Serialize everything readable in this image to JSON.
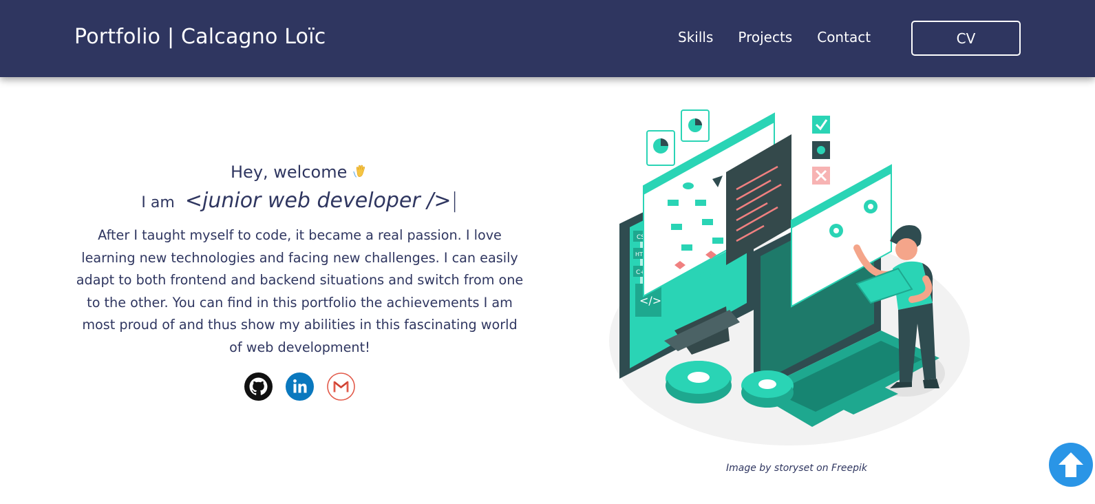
{
  "header": {
    "brand": "Portfolio | Calcagno Loïc",
    "nav": [
      {
        "label": "Skills"
      },
      {
        "label": "Projects"
      },
      {
        "label": "Contact"
      }
    ],
    "cv_label": "CV"
  },
  "hero": {
    "greeting": "Hey, welcome",
    "iam_prefix": "I am",
    "role": "<junior web developer />",
    "cursor": "|",
    "bio": "After I taught myself to code, it became a real passion. I love learning new technologies and facing new challenges. I can easily adapt to both frontend and backend situations and switch from one to the other. You can find in this portfolio the achievements I am most proud of and thus show my abilities in this fascinating world of web development!",
    "socials": [
      {
        "icon": "github-icon"
      },
      {
        "icon": "linkedin-icon"
      },
      {
        "icon": "gmail-icon"
      }
    ]
  },
  "illustration": {
    "credit": "Image by storyset on Freepik"
  },
  "colors": {
    "navbar": "#2f3660",
    "text": "#2f3660",
    "accent": "#1ed8b8",
    "scroll_button": "#2a95e6"
  }
}
